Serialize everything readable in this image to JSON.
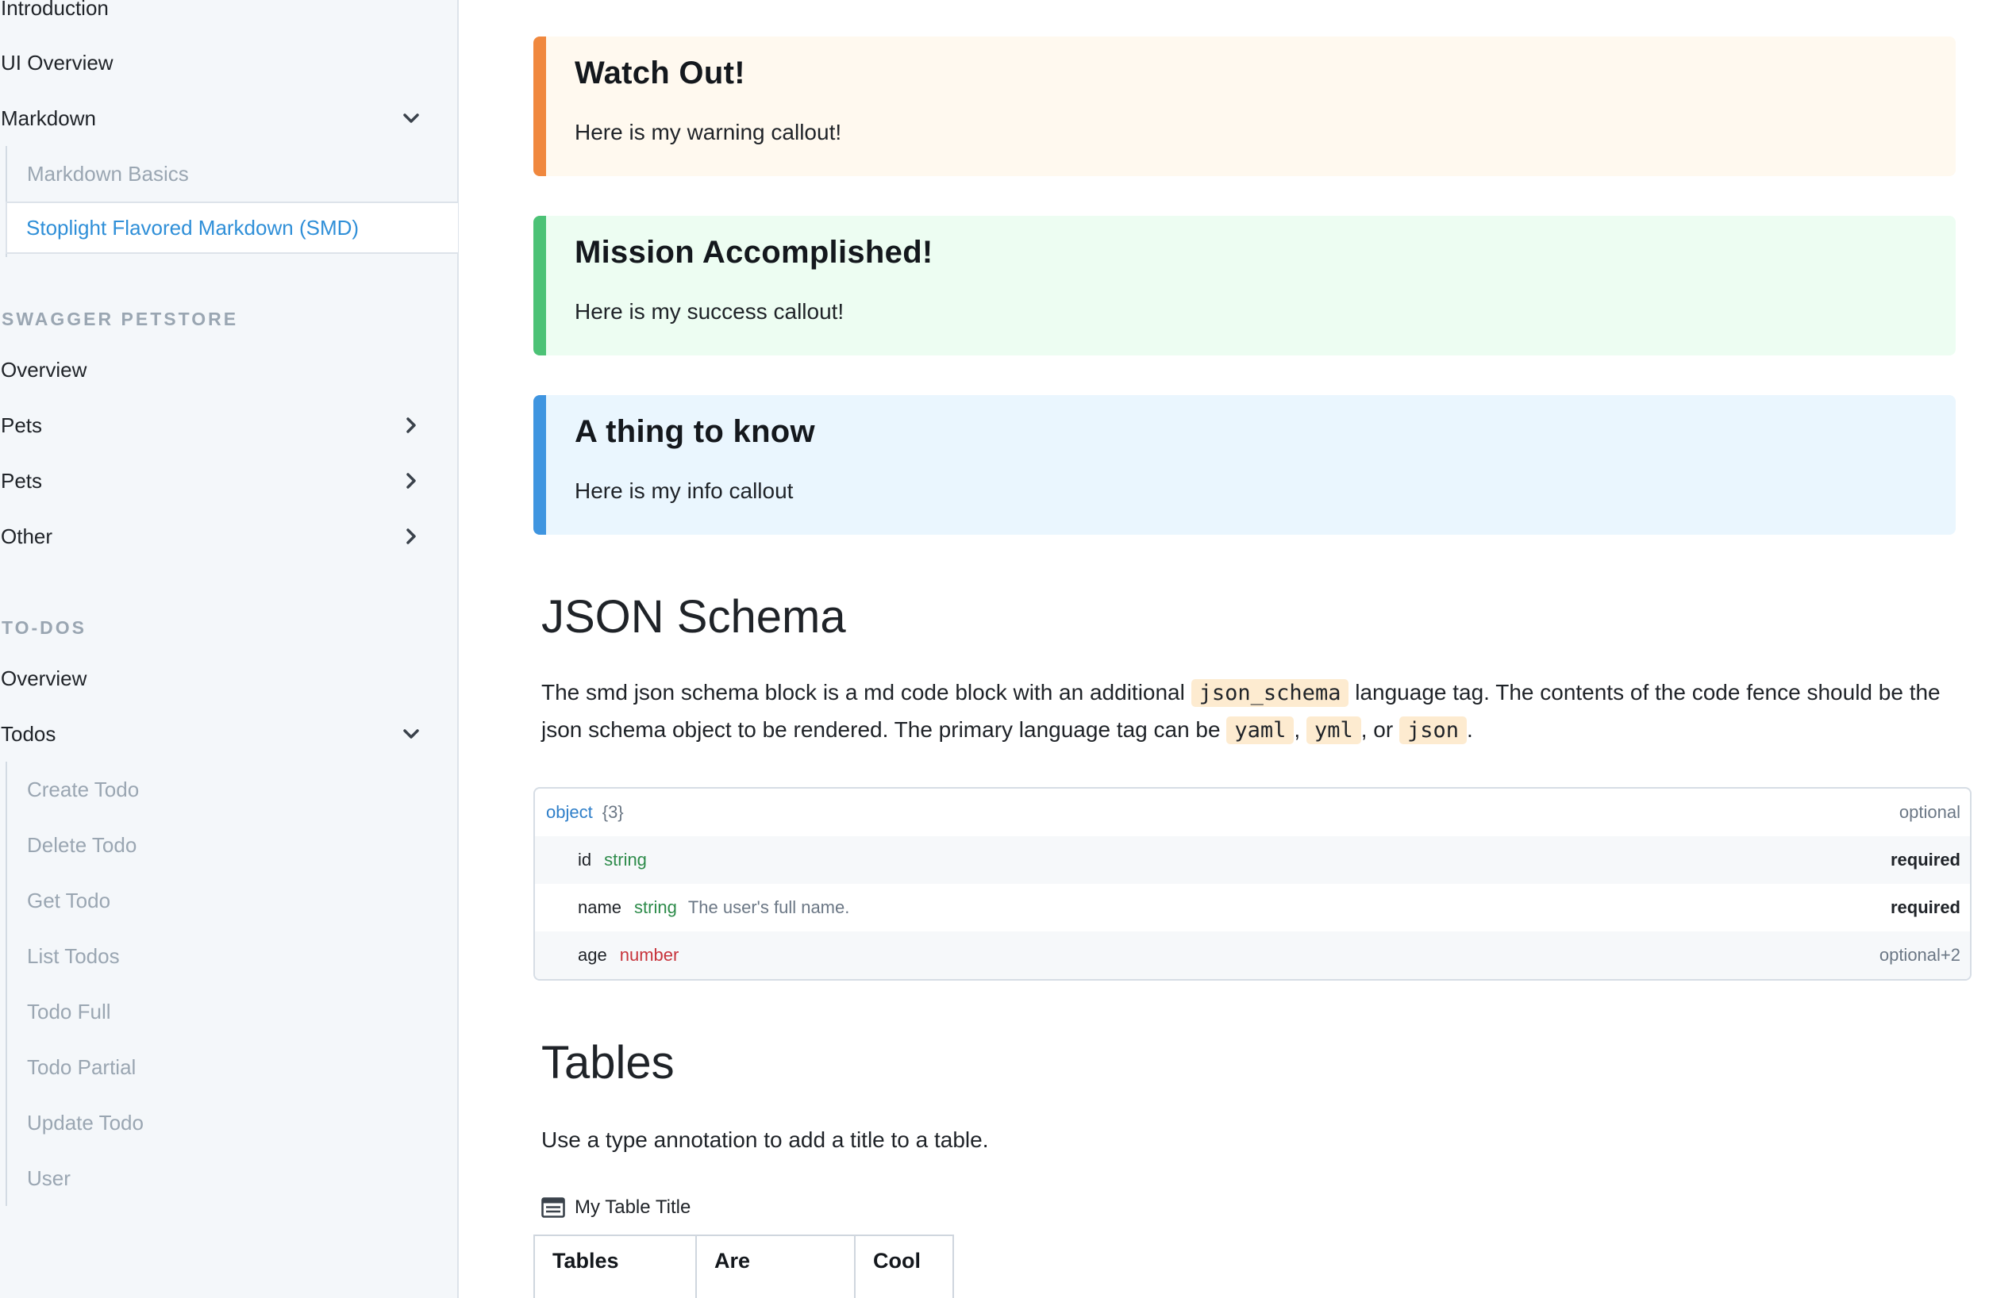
{
  "sidebar": {
    "top_items": [
      {
        "label": "Introduction"
      },
      {
        "label": "UI Overview"
      },
      {
        "label": "Markdown",
        "chevron": "chevron-down"
      }
    ],
    "markdown_children": [
      {
        "label": "Markdown Basics",
        "active": false
      },
      {
        "label": "Stoplight Flavored Markdown (SMD)",
        "active": true
      }
    ],
    "petstore": {
      "heading": "SWAGGER PETSTORE",
      "items": [
        {
          "label": "Overview"
        },
        {
          "label": "Pets",
          "chevron": "chevron-right"
        },
        {
          "label": "Pets",
          "chevron": "chevron-right"
        },
        {
          "label": "Other",
          "chevron": "chevron-right"
        }
      ]
    },
    "todos": {
      "heading": "TO-DOS",
      "items": [
        {
          "label": "Overview"
        },
        {
          "label": "Todos",
          "chevron": "chevron-down"
        }
      ],
      "children": [
        {
          "label": "Create Todo"
        },
        {
          "label": "Delete Todo"
        },
        {
          "label": "Get Todo"
        },
        {
          "label": "List Todos"
        },
        {
          "label": "Todo Full"
        },
        {
          "label": "Todo Partial"
        },
        {
          "label": "Update Todo"
        },
        {
          "label": "User"
        }
      ]
    }
  },
  "callouts": [
    {
      "title": "Watch Out!",
      "body": "Here is my warning callout!",
      "accent": "#f0883e",
      "bg": "#fff9ef"
    },
    {
      "title": "Mission Accomplished!",
      "body": "Here is my success callout!",
      "accent": "#4cc276",
      "bg": "#edfdf2"
    },
    {
      "title": "A thing to know",
      "body": "Here is my info callout",
      "accent": "#3f95e0",
      "bg": "#eaf6fe"
    }
  ],
  "json_schema_section": {
    "heading": "JSON Schema",
    "para_part1": "The smd json schema block is a md code block with an additional ",
    "code1": "json_schema",
    "para_part2": " language tag. The contents of the code fence should be the json schema object to be rendered. The primary language tag can be ",
    "code2": "yaml",
    "sep1": ", ",
    "code3": "yml",
    "sep2": ", or ",
    "code4": "json",
    "para_end": "."
  },
  "schema_viewer": {
    "root_type": "object",
    "root_count": "{3}",
    "root_flag": "optional",
    "properties": [
      {
        "name": "id",
        "type": "string",
        "description": "",
        "flag": "required"
      },
      {
        "name": "name",
        "type": "string",
        "description": "The user's full name.",
        "flag": "required"
      },
      {
        "name": "age",
        "type": "number",
        "description": "",
        "flag": "optional+2"
      }
    ]
  },
  "tables_section": {
    "heading": "Tables",
    "para": "Use a type annotation to add a title to a table.",
    "table_title": "My Table Title",
    "columns": [
      "Tables",
      "Are",
      "Cool"
    ]
  }
}
